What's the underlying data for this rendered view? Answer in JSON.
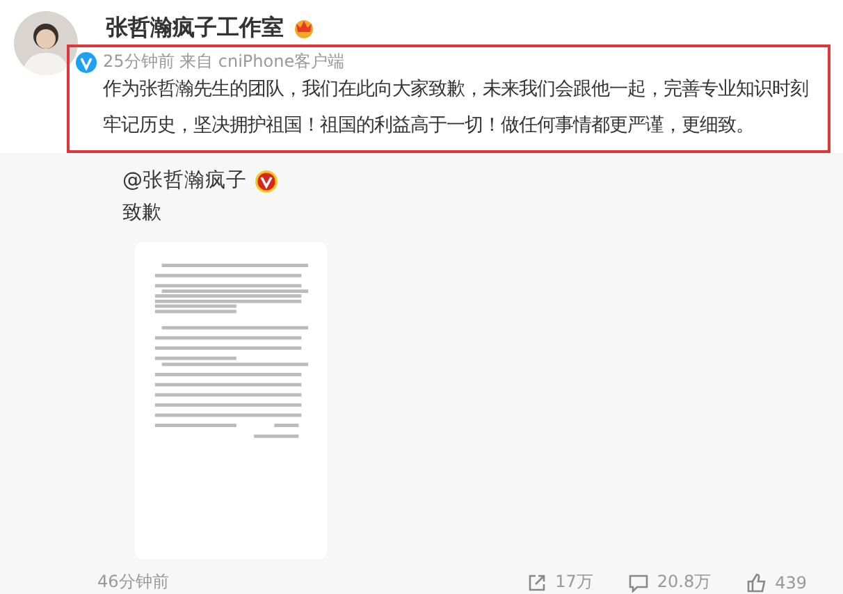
{
  "author": {
    "name": "张哲瀚疯子工作室",
    "verified": true
  },
  "meta": {
    "time": "25分钟前",
    "source": "来自 cniPhone客户端"
  },
  "content": "作为张哲瀚先生的团队，我们在此向大家致歉，未来我们会跟他一起，完善专业知识时刻牢记历史，坚决拥护祖国！祖国的利益高于一切！做任何事情都更严谨，更细致。",
  "highlighted": true,
  "repost": {
    "author": "@张哲瀚疯子",
    "verified": true,
    "text": "致歉",
    "footer": {
      "time": "46分钟前",
      "shares": "17万",
      "comments": "20.8万",
      "likes": "439"
    }
  }
}
